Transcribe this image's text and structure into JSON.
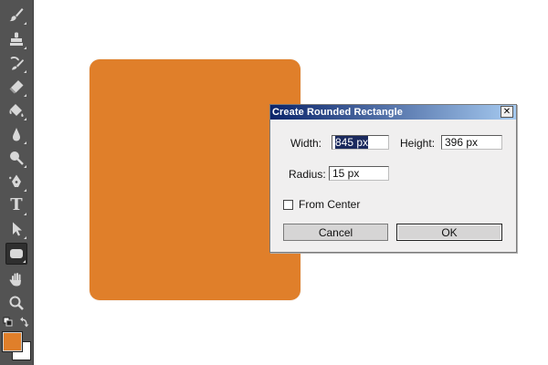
{
  "colors": {
    "toolbar_bg": "#535353",
    "icon": "#d8d8d8",
    "shape_fill": "#e07f2a",
    "foreground_swatch": "#e07f2a",
    "background_swatch": "#ffffff",
    "dialog_title_start": "#0a246a",
    "dialog_title_end": "#a6caf0"
  },
  "toolbar": {
    "tools": [
      "brush-icon",
      "clone-stamp-icon",
      "history-brush-icon",
      "eraser-icon",
      "paint-bucket-icon",
      "blur-icon",
      "dodge-icon",
      "pen-icon",
      "type-icon",
      "path-selection-icon",
      "rounded-rectangle-icon",
      "hand-icon",
      "zoom-icon"
    ],
    "type_glyph": "T"
  },
  "dialog": {
    "title": "Create Rounded Rectangle",
    "close_glyph": "✕",
    "width_label": "Width:",
    "width_value": "845 px",
    "height_label": "Height:",
    "height_value": "396 px",
    "radius_label": "Radius:",
    "radius_value": "15 px",
    "from_center_label": "From Center",
    "from_center_checked": false,
    "cancel_label": "Cancel",
    "ok_label": "OK"
  }
}
